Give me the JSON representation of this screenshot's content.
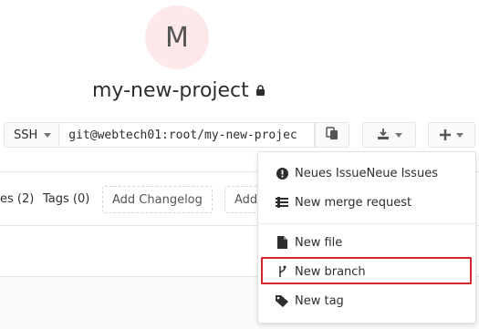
{
  "project": {
    "avatar_letter": "M",
    "name": "my-new-project"
  },
  "clone": {
    "protocol": "SSH",
    "url": "git@webtech01:root/my-new-projec"
  },
  "tabs": {
    "issues_partial": "es (2)",
    "tags": "Tags (0)",
    "add_changelog": "Add Changelog",
    "partial_add": "Add"
  },
  "dropdown": {
    "items": [
      {
        "label": "Neues IssueNeue Issues",
        "icon": "exclamation-circle-icon"
      },
      {
        "label": "New merge request",
        "icon": "merge-request-icon"
      },
      {
        "label": "New file",
        "icon": "file-icon"
      },
      {
        "label": "New branch",
        "icon": "branch-icon"
      },
      {
        "label": "New tag",
        "icon": "tag-icon"
      }
    ]
  },
  "colors": {
    "avatar_bg": "#fde8ea",
    "highlight": "#d0282e"
  }
}
